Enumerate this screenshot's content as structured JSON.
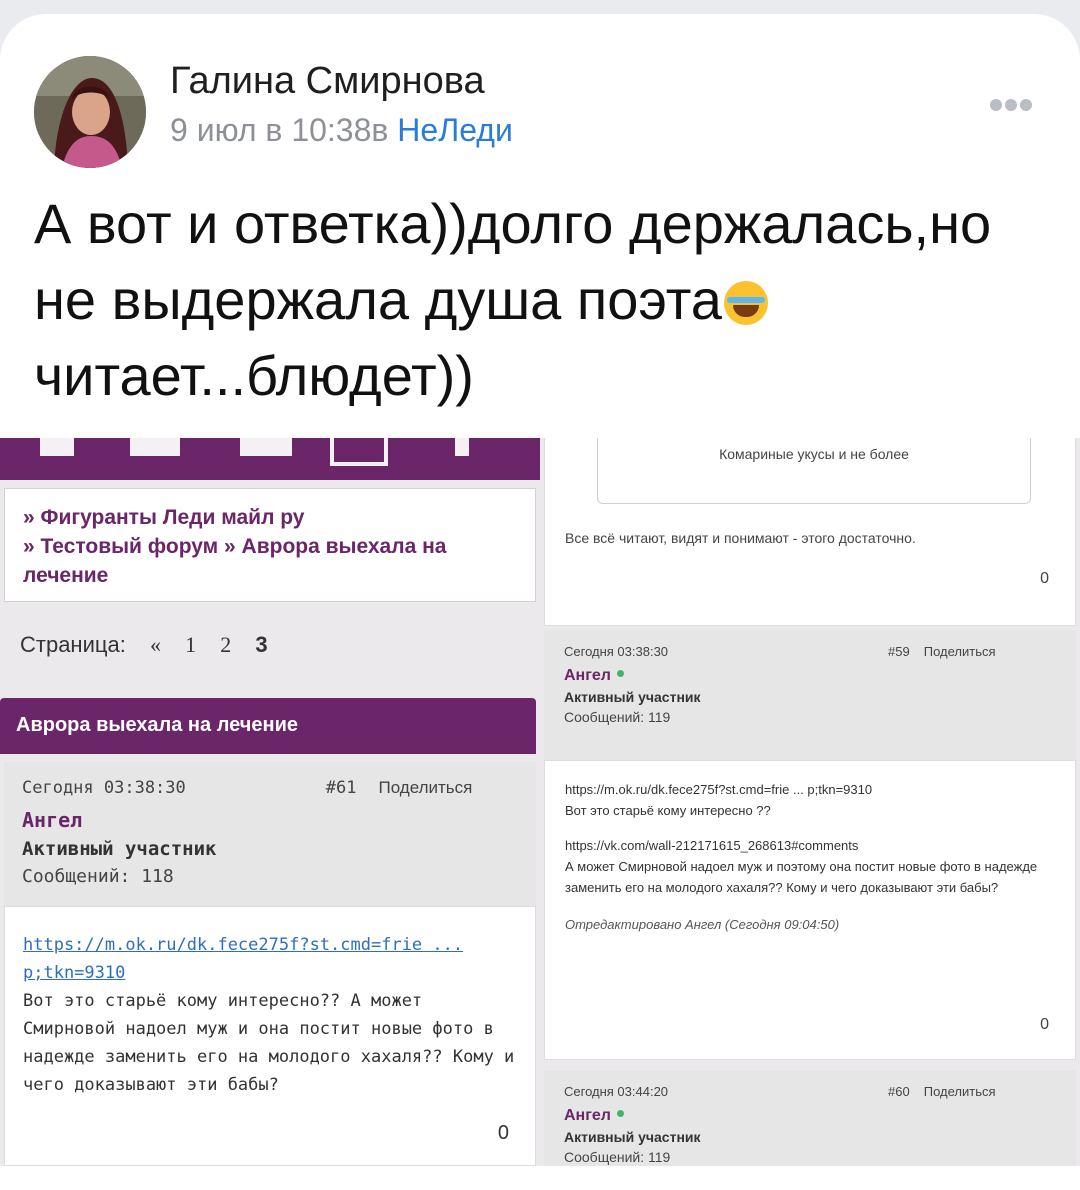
{
  "author": {
    "name": "Галина Смирнова",
    "date": "9 июл в 10:38в",
    "group": "НеЛеди"
  },
  "post": {
    "text_before_emoji": "А вот и ответка))долго держалась,но не выдержала душа поэта",
    "emoji": "joy-emoji",
    "text_after_emoji": " читает...блюдет))"
  },
  "screenshot": {
    "left": {
      "breadcrumbs": {
        "line1": "» Фигуранты Леди майл ру",
        "line2": "» Тестовый форум » Аврора выехала на лечение"
      },
      "pager": {
        "label": "Страница:",
        "prev": "«",
        "p1": "1",
        "p2": "2",
        "p3": "3"
      },
      "topic_title": "Аврора выехала на лечение",
      "post": {
        "date": "Сегодня 03:38:30",
        "number": "#61",
        "share": "Поделиться",
        "author": "Ангел",
        "role": "Активный участник",
        "messages": "Сообщений: 118",
        "link1": "https://m.ok.ru/dk.fece275f?st.cmd=frie ...",
        "link2": "p;tkn=9310",
        "text": "Вот это старьё кому интересно?? А может Смирновой надоел муж и она постит новые фото в надежде заменить его на молодого хахаля?? Кому и чего доказывают эти бабы?",
        "likes": "0"
      }
    },
    "right": {
      "quote_text": "Комариные укусы и не более",
      "reply_text": "Все всё читают, видят и понимают - этого достаточно.",
      "likes_top": "0",
      "post59": {
        "date": "Сегодня 03:38:30",
        "number": "#59",
        "share": "Поделиться",
        "author": "Ангел",
        "role": "Активный участник",
        "messages": "Сообщений: 119",
        "link1": "https://m.ok.ru/dk.fece275f?st.cmd=frie ... p;tkn=9310",
        "line1": "Вот это старьё кому интересно ??",
        "link2": "https://vk.com/wall-212171615_268613#comments",
        "line2": "А может Смирновой надоел муж и поэтому она постит новые фото в надежде заменить его на молодого хахаля?? Кому и чего доказывают эти бабы?",
        "edited": "Отредактировано Ангел (Сегодня 09:04:50)",
        "likes": "0"
      },
      "post60": {
        "date": "Сегодня 03:44:20",
        "number": "#60",
        "share": "Поделиться",
        "author": "Ангел",
        "role": "Активный участник",
        "messages": "Сообщений: 119"
      }
    }
  }
}
